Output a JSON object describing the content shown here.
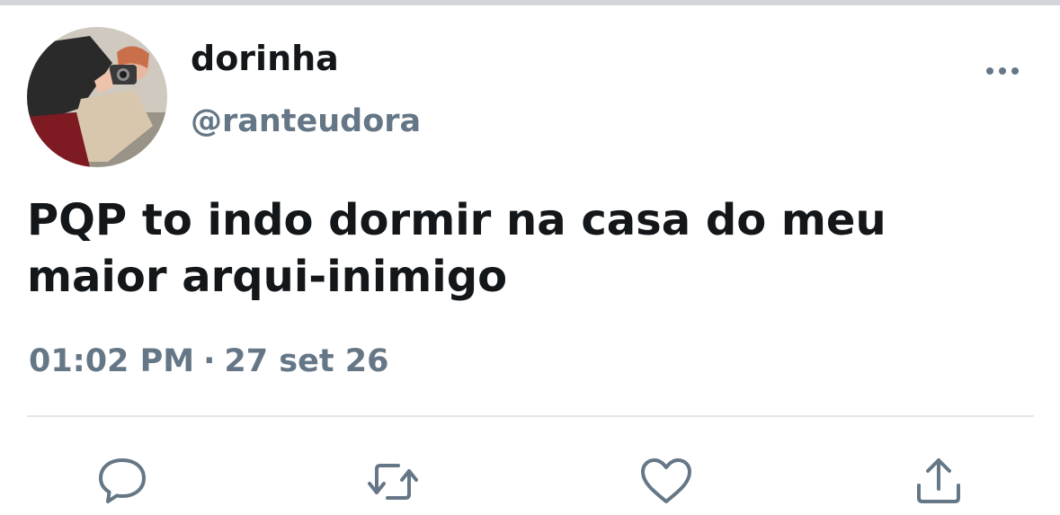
{
  "tweet": {
    "display_name": "dorinha",
    "handle": "@ranteudora",
    "text_lines": [
      "PQP to indo dormir na casa do meu",
      "maior arqui-inimigo"
    ],
    "time": "01:02 PM",
    "separator": "·",
    "date": "27 set 26"
  },
  "icons": {
    "avatar": "profile-photo",
    "more": "more-options-icon",
    "reply": "reply-bubble-icon",
    "retweet": "retweet-arrows-icon",
    "like": "heart-icon",
    "share": "share-upload-icon"
  },
  "colors": {
    "text_primary": "#14171a",
    "text_secondary": "#657786",
    "icon": "#657786",
    "divider": "#e1e8ed",
    "background": "#ffffff"
  }
}
